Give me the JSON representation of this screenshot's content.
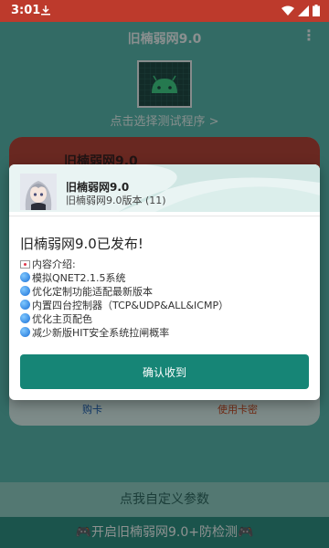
{
  "status_bar": {
    "time": "3:01"
  },
  "app": {
    "title": "旧楠弱网9.0",
    "menu_glyph": "⋮",
    "select_prompt": "点击选择测试程序 >",
    "bg_card_title": "旧楠弱网9.0",
    "buy_card": "购卡",
    "use_card": "使用卡密",
    "custom_params": "点我自定义参数",
    "start_button": "🎮开启旧楠弱网9.0+防检测🎮"
  },
  "dialog": {
    "app_name": "旧楠弱网9.0",
    "app_version": "旧楠弱网9.0版本 (11)",
    "headline": "旧楠弱网9.0已发布!",
    "intro": "内容介绍:",
    "items": [
      "模拟QNET2.1.5系统",
      "优化定制功能适配最新版本",
      "内置四台控制器（TCP&UDP&ALL&ICMP）",
      "优化主页配色",
      "减少新版HIT安全系统拉闸概率"
    ],
    "confirm_button": "确认收到"
  },
  "colors": {
    "accent": "#168576",
    "status_bar": "#bd3a2c",
    "background": "#58b9ae"
  }
}
